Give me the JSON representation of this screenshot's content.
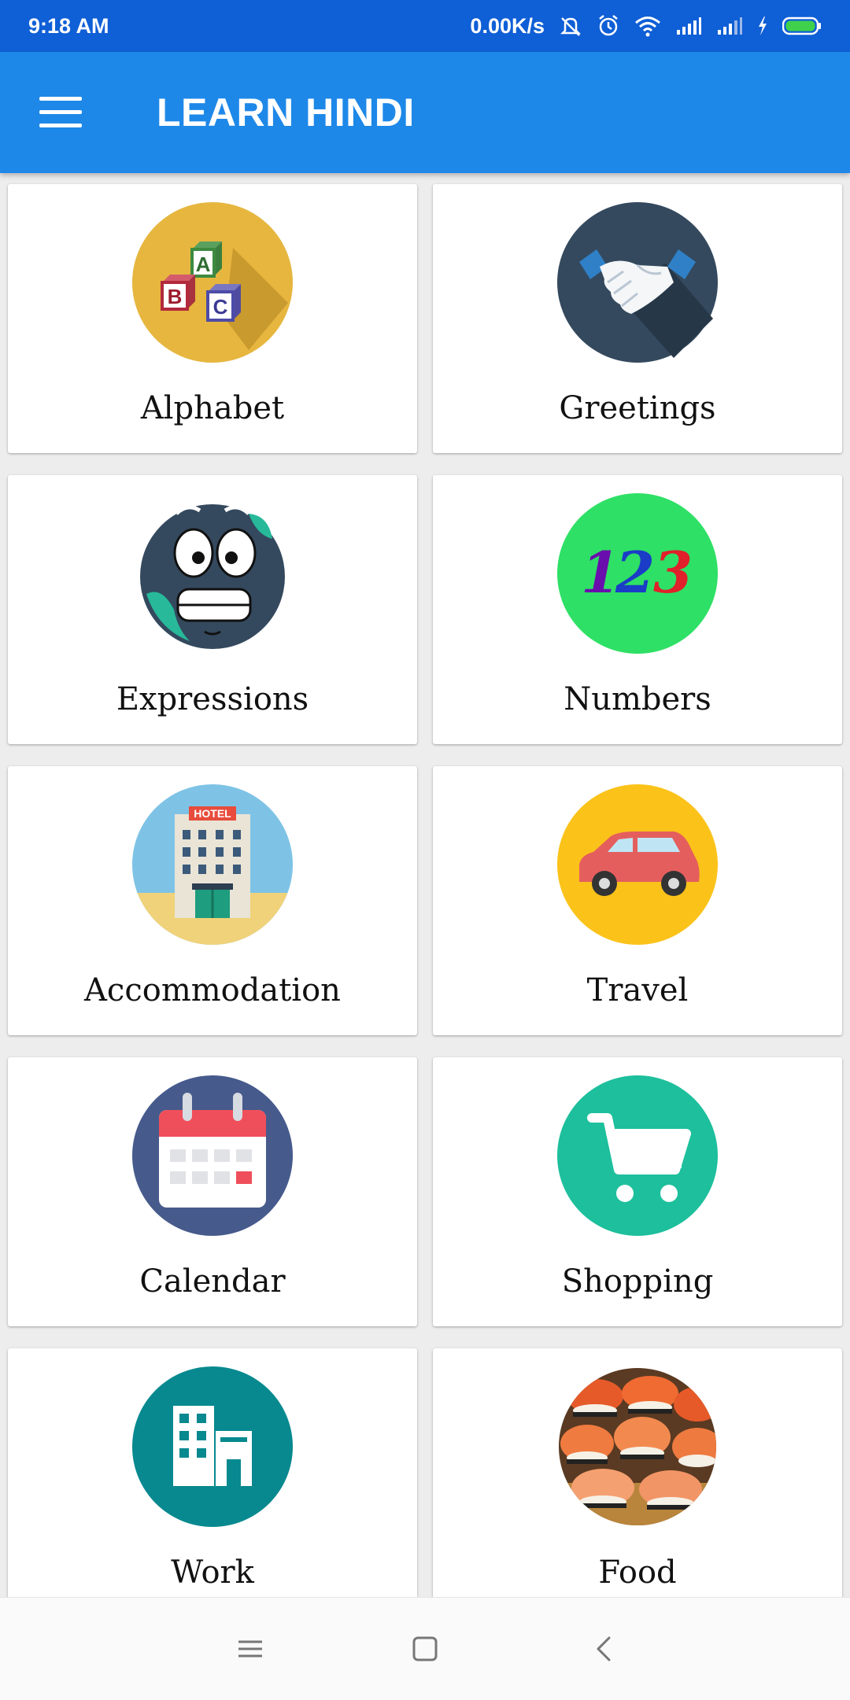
{
  "status_bar": {
    "time": "9:18 AM",
    "net_speed": "0.00K/s",
    "icons": [
      "mute-icon",
      "alarm-icon",
      "wifi-icon",
      "signal-icon",
      "signal-icon",
      "charging-icon",
      "battery-icon"
    ]
  },
  "app_bar": {
    "title": "LEARN HINDI",
    "menu_icon": "hamburger-icon"
  },
  "categories": [
    {
      "label": "Alphabet",
      "icon": "abc-blocks-icon"
    },
    {
      "label": "Greetings",
      "icon": "handshake-icon"
    },
    {
      "label": "Expressions",
      "icon": "face-icon"
    },
    {
      "label": "Numbers",
      "icon": "numbers-123-icon"
    },
    {
      "label": "Accommodation",
      "icon": "hotel-icon",
      "icon_text": "HOTEL"
    },
    {
      "label": "Travel",
      "icon": "car-icon"
    },
    {
      "label": "Calendar",
      "icon": "calendar-icon"
    },
    {
      "label": "Shopping",
      "icon": "cart-icon"
    },
    {
      "label": "Work",
      "icon": "office-building-icon"
    },
    {
      "label": "Food",
      "icon": "sushi-icon"
    }
  ],
  "numbers_icon_digits": [
    "1",
    "2",
    "3"
  ],
  "nav_bar": {
    "buttons": [
      "menu-icon",
      "home-icon",
      "back-icon"
    ]
  },
  "colors": {
    "status_bar": "#0f5fd6",
    "app_bar": "#1e88e8",
    "background": "#ededed",
    "card": "#ffffff"
  }
}
